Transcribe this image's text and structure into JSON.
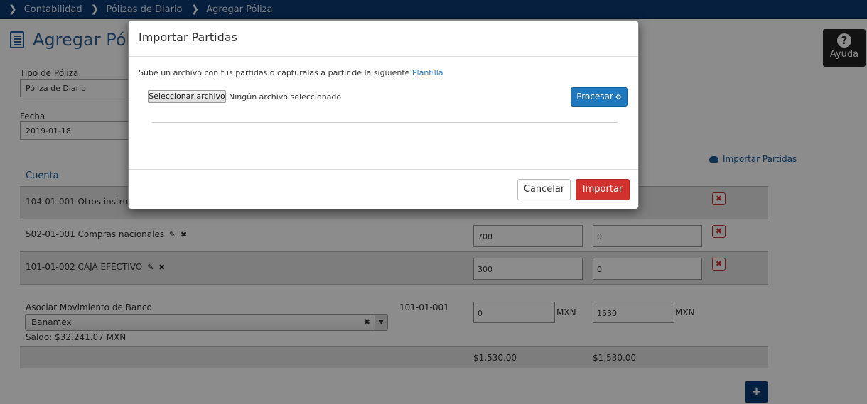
{
  "breadcrumb": [
    "Contabilidad",
    "Pólizas de Diario",
    "Agregar Póliza"
  ],
  "page": {
    "title": "Agregar Póliza"
  },
  "help": {
    "label": "Ayuda"
  },
  "form": {
    "tipo_label": "Tipo de Póliza",
    "tipo_value": "Póliza de Diario",
    "fecha_label": "Fecha",
    "fecha_value": "2019-01-18"
  },
  "import_link": "Importar Partidas",
  "table": {
    "cuenta_header": "Cuenta",
    "rows": [
      {
        "account": "104-01-001 Otros instrumentos financieros",
        "debit": "",
        "credit": ""
      },
      {
        "account": "502-01-001 Compras nacionales",
        "debit": "700",
        "credit": "0"
      },
      {
        "account": "101-01-002 CAJA EFECTIVO",
        "debit": "300",
        "credit": "0"
      }
    ]
  },
  "bank": {
    "label": "Asociar Movimiento de Banco",
    "selected": "Banamex",
    "balance": "Saldo: $32,241.07 MXN",
    "account": "101-01-001",
    "debit": "0",
    "credit": "1530",
    "currency": "MXN"
  },
  "totals": {
    "debit": "$1,530.00",
    "credit": "$1,530.00"
  },
  "add_label": "+",
  "modal": {
    "title": "Importar Partidas",
    "description": "Sube un archivo con tus partidas o capturalas a partir de la siguiente",
    "template_link": "Plantilla",
    "file_button": "Seleccionar archivo",
    "file_status": "Ningún archivo seleccionado",
    "process_button": "Procesar",
    "cancel_button": "Cancelar",
    "import_button": "Importar"
  },
  "colors": {
    "nav": "#0b3a73",
    "primary": "#1f77bd",
    "danger": "#d2322d",
    "link": "#2a7bc0"
  }
}
